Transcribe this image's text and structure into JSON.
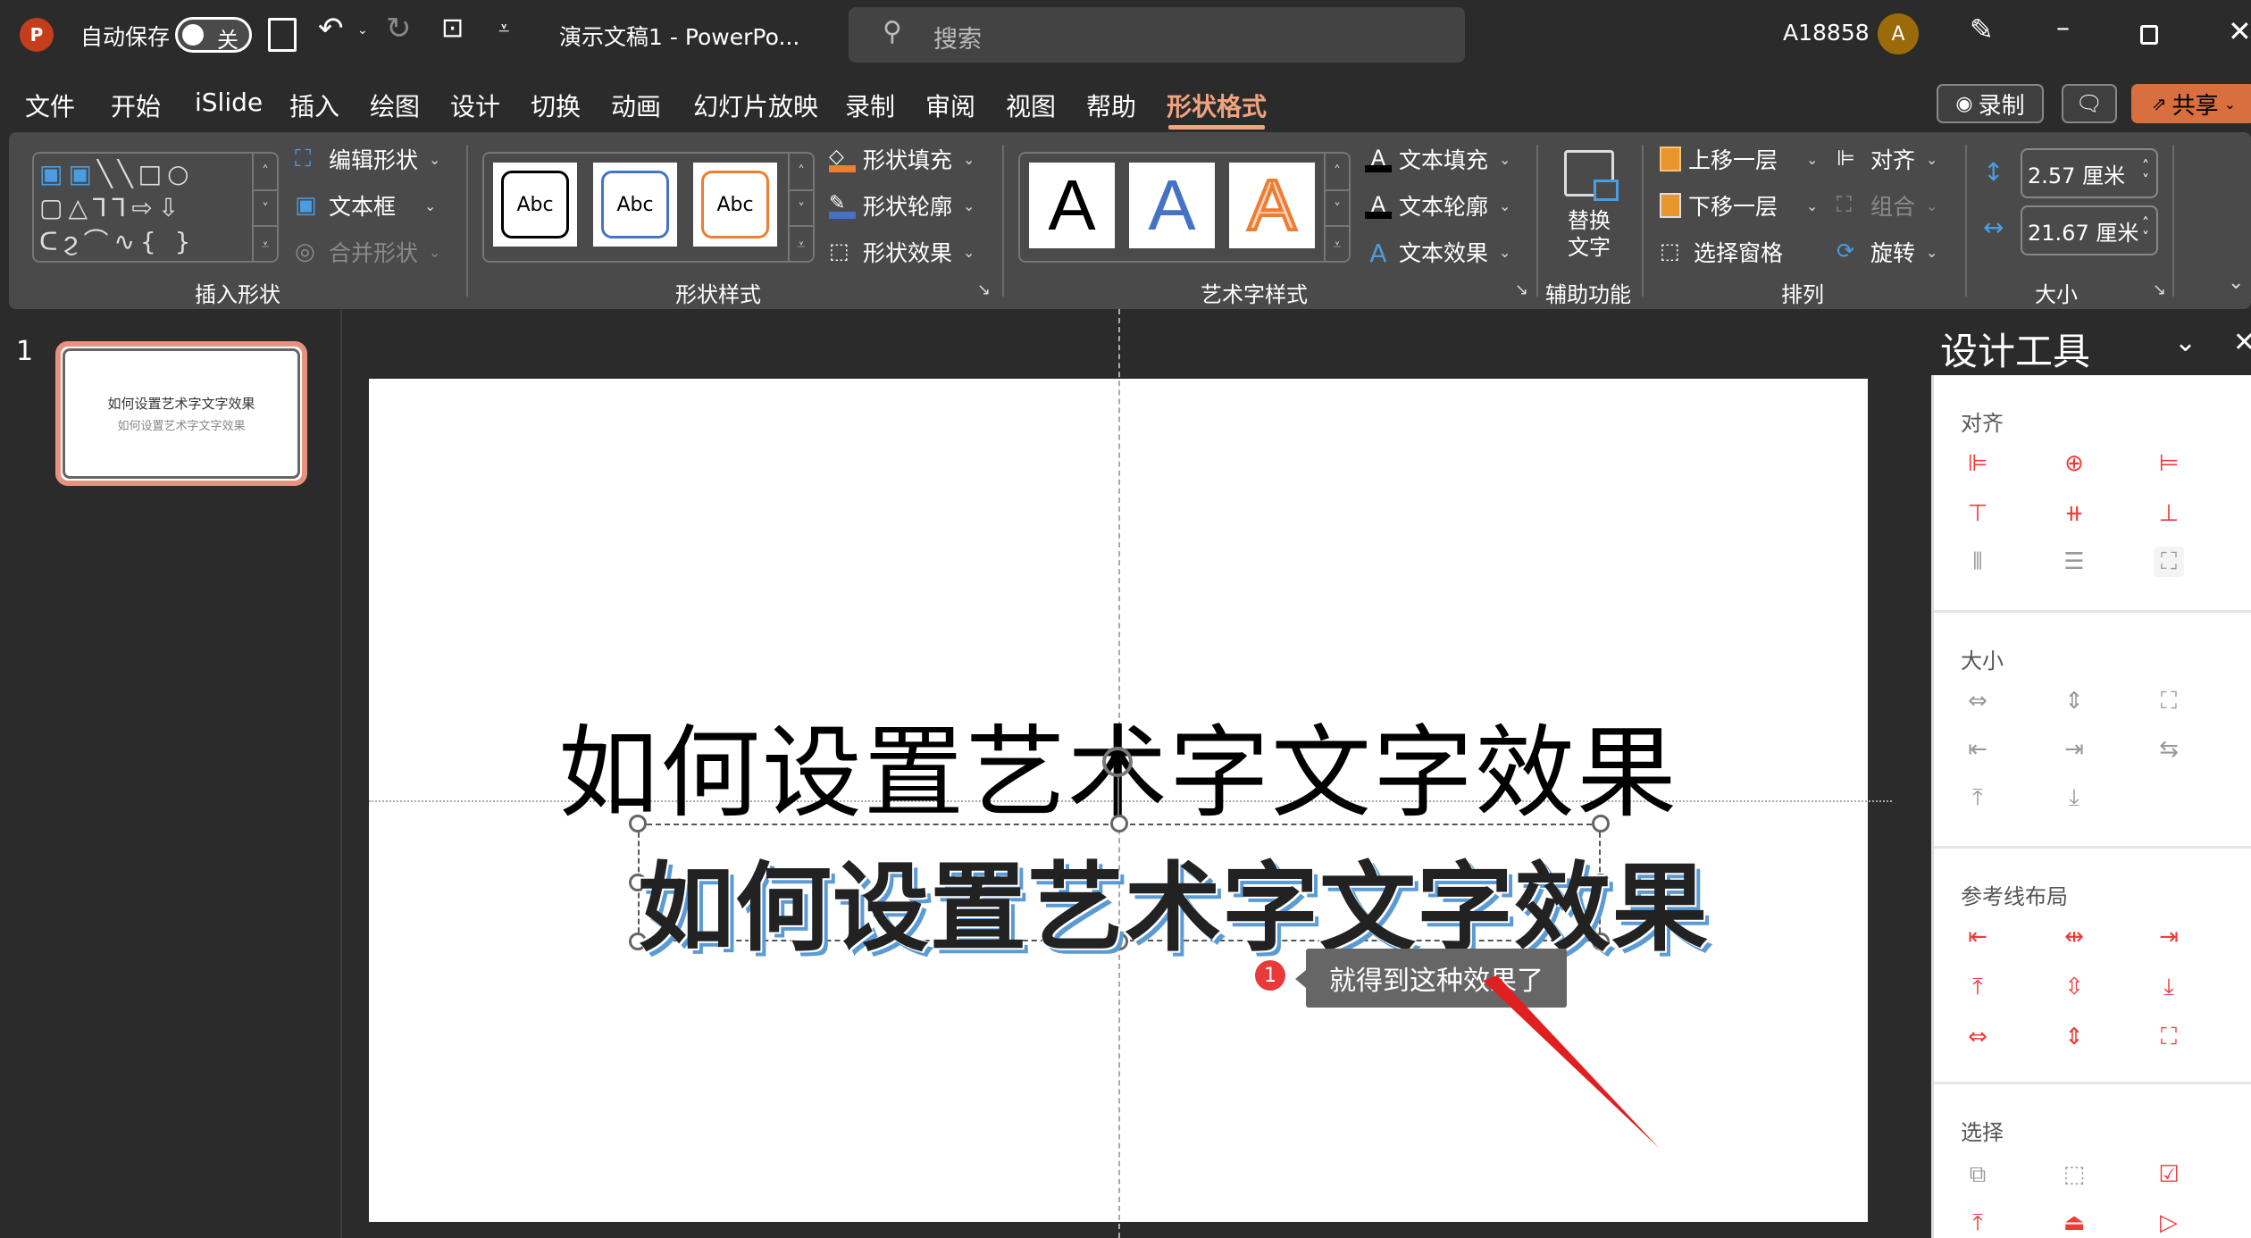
{
  "titlebar": {
    "autosave_label": "自动保存",
    "autosave_state": "关",
    "document_title": "演示文稿1  -  PowerPo...",
    "search_placeholder": "搜索",
    "user_name": "A18858",
    "avatar_initial": "A"
  },
  "tabs": [
    {
      "label": "文件"
    },
    {
      "label": "开始"
    },
    {
      "label": "iSlide"
    },
    {
      "label": "插入"
    },
    {
      "label": "绘图"
    },
    {
      "label": "设计"
    },
    {
      "label": "切换"
    },
    {
      "label": "动画"
    },
    {
      "label": "幻灯片放映"
    },
    {
      "label": "录制"
    },
    {
      "label": "审阅"
    },
    {
      "label": "视图"
    },
    {
      "label": "帮助"
    },
    {
      "label": "形状格式",
      "active": true
    }
  ],
  "tab_actions": {
    "record": "录制",
    "share": "共享"
  },
  "ribbon": {
    "insert_shape": {
      "label": "插入形状",
      "edit_shape": "编辑形状",
      "text_box": "文本框",
      "merge_shapes": "合并形状"
    },
    "shape_styles": {
      "label": "形状样式",
      "previews": [
        "Abc",
        "Abc",
        "Abc"
      ],
      "preview_colors": [
        "#000000",
        "#4472c4",
        "#ed7d31"
      ],
      "fill": "形状填充",
      "outline": "形状轮廓",
      "effects": "形状效果"
    },
    "wordart_styles": {
      "label": "艺术字样式",
      "previews": [
        "A",
        "A",
        "A"
      ],
      "text_fill": "文本填充",
      "text_outline": "文本轮廓",
      "text_effects": "文本效果"
    },
    "accessibility": {
      "label": "辅助功能",
      "alt_text_line1": "替换",
      "alt_text_line2": "文字"
    },
    "arrange": {
      "label": "排列",
      "bring_forward": "上移一层",
      "send_backward": "下移一层",
      "selection_pane": "选择窗格",
      "align": "对齐",
      "group": "组合",
      "rotate": "旋转"
    },
    "size": {
      "label": "大小",
      "height": "2.57 厘米",
      "width": "21.67 厘米"
    }
  },
  "slides_panel": {
    "slide_number": "1",
    "thumb_title": "如何设置艺术字文字效果",
    "thumb_subtitle": "如何设置艺术字文字效果"
  },
  "slide": {
    "title_plain": "如何设置艺术字文字效果",
    "title_wordart": "如何设置艺术字文字效果"
  },
  "annotation": {
    "badge": "1",
    "text": "就得到这种效果了"
  },
  "design_panel": {
    "title": "设计工具",
    "sections": {
      "align": "对齐",
      "size": "大小",
      "guides": "参考线布局",
      "select": "选择"
    }
  }
}
